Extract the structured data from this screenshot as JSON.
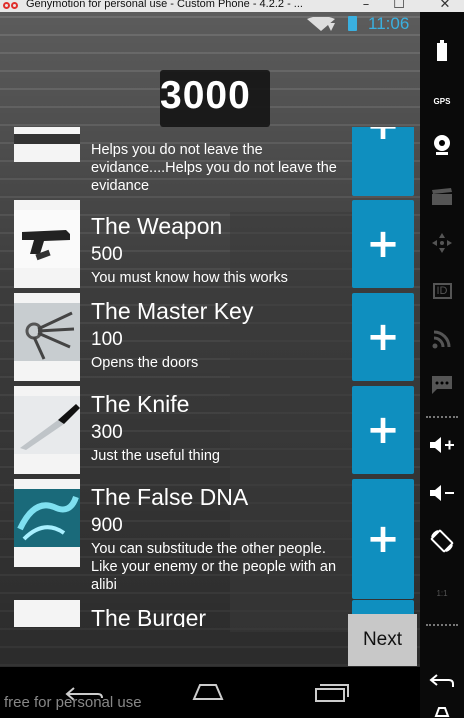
{
  "window": {
    "title": "Genymotion for personal use - Custom Phone - 4.2.2 - ...",
    "buttons": [
      "–",
      "☐",
      "✕"
    ]
  },
  "status_bar": {
    "time": "11:06",
    "battery_color": "#3ab0e0"
  },
  "score": "3000",
  "items": [
    {
      "name": "",
      "price": "",
      "description": "Helps you do not leave the evidance....Helps you do not leave the evidance",
      "thumbnail_icon": "gloves-icon",
      "plus_label": "+"
    },
    {
      "name": "The Weapon",
      "price": "500",
      "description": "You must know how this works",
      "thumbnail_icon": "pistol-icon",
      "plus_label": "+"
    },
    {
      "name": "The Master Key",
      "price": "100",
      "description": "Opens the doors",
      "thumbnail_icon": "keys-icon",
      "plus_label": "+"
    },
    {
      "name": "The Knife",
      "price": "300",
      "description": "Just the useful thing",
      "thumbnail_icon": "knife-icon",
      "plus_label": "+"
    },
    {
      "name": "The False DNA",
      "price": "900",
      "description": "You can substitude the other people. Like your enemy or the people with an alibi",
      "thumbnail_icon": "dna-icon",
      "plus_label": "+"
    },
    {
      "name": "The Burger",
      "price": "",
      "description": "",
      "thumbnail_icon": "burger-icon",
      "plus_label": ""
    }
  ],
  "next_button": "Next",
  "watermark": "free for personal use",
  "sidebar": {
    "gps_label": "GPS",
    "id_label": "ID",
    "scale_label": "1:1"
  },
  "colors": {
    "accent": "#0f8fbf",
    "next_button_bg": "#c8c8c8"
  }
}
